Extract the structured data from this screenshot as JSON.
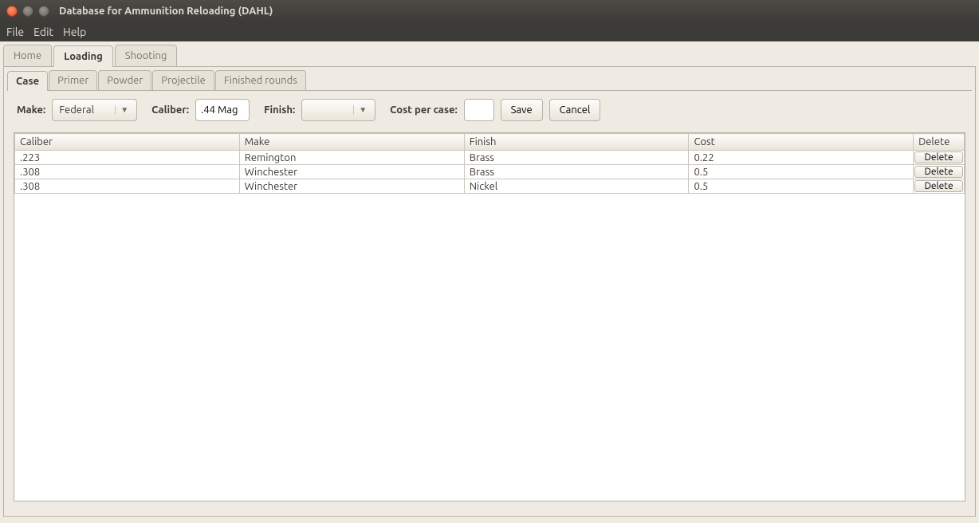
{
  "window": {
    "title": "Database for Ammunition Reloading (DAHL)"
  },
  "menu": {
    "file": "File",
    "edit": "Edit",
    "help": "Help"
  },
  "tabs": {
    "home": "Home",
    "loading": "Loading",
    "shooting": "Shooting"
  },
  "subtabs": {
    "case": "Case",
    "primer": "Primer",
    "powder": "Powder",
    "projectile": "Projectile",
    "finished": "Finished rounds"
  },
  "form": {
    "make_label": "Make:",
    "make_value": "Federal",
    "caliber_label": "Caliber:",
    "caliber_value": ".44 Mag",
    "finish_label": "Finish:",
    "finish_value": "",
    "cost_label": "Cost per case:",
    "cost_value": "",
    "save": "Save",
    "cancel": "Cancel"
  },
  "table": {
    "headers": {
      "caliber": "Caliber",
      "make": "Make",
      "finish": "Finish",
      "cost": "Cost",
      "delete": "Delete"
    },
    "delete_label": "Delete",
    "rows": [
      {
        "caliber": ".223",
        "make": "Remington",
        "finish": "Brass",
        "cost": "0.22"
      },
      {
        "caliber": ".308",
        "make": "Winchester",
        "finish": "Brass",
        "cost": "0.5"
      },
      {
        "caliber": ".308",
        "make": "Winchester",
        "finish": "Nickel",
        "cost": "0.5"
      }
    ]
  }
}
